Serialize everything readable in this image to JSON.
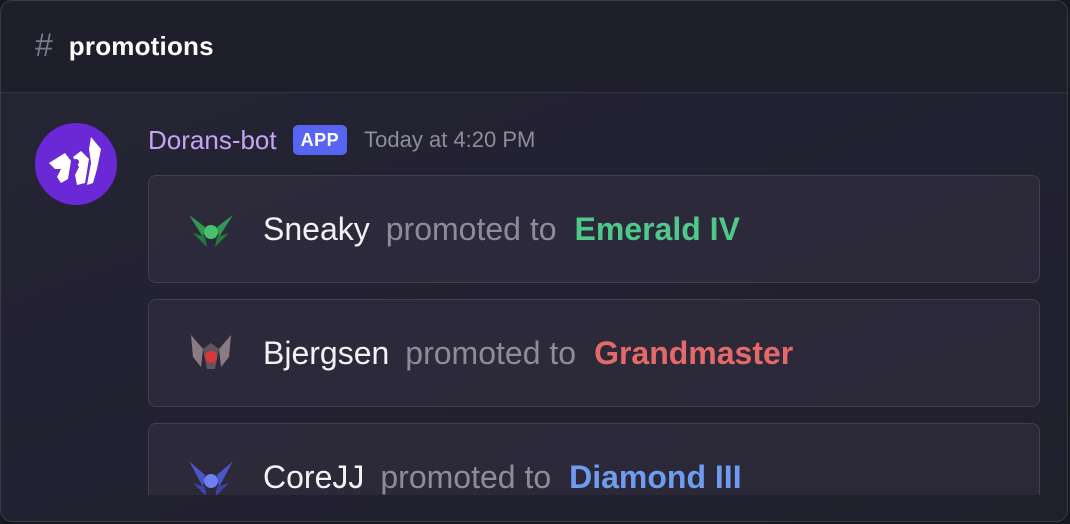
{
  "channel": {
    "hash_symbol": "#",
    "name": "promotions"
  },
  "message": {
    "author": "Dorans-bot",
    "badge": "APP",
    "timestamp": "Today at 4:20 PM",
    "avatar_color": "#6a28d6",
    "promotions": [
      {
        "player": "Sneaky",
        "verb": "promoted to",
        "rank": "Emerald IV",
        "rank_color": "#4fc98a",
        "emblem": "emerald-rank-icon"
      },
      {
        "player": "Bjergsen",
        "verb": "promoted to",
        "rank": "Grandmaster",
        "rank_color": "#e6696a",
        "emblem": "grandmaster-rank-icon"
      },
      {
        "player": "CoreJJ",
        "verb": "promoted to",
        "rank": "Diamond III",
        "rank_color": "#6f9cf0",
        "emblem": "diamond-rank-icon"
      }
    ]
  }
}
